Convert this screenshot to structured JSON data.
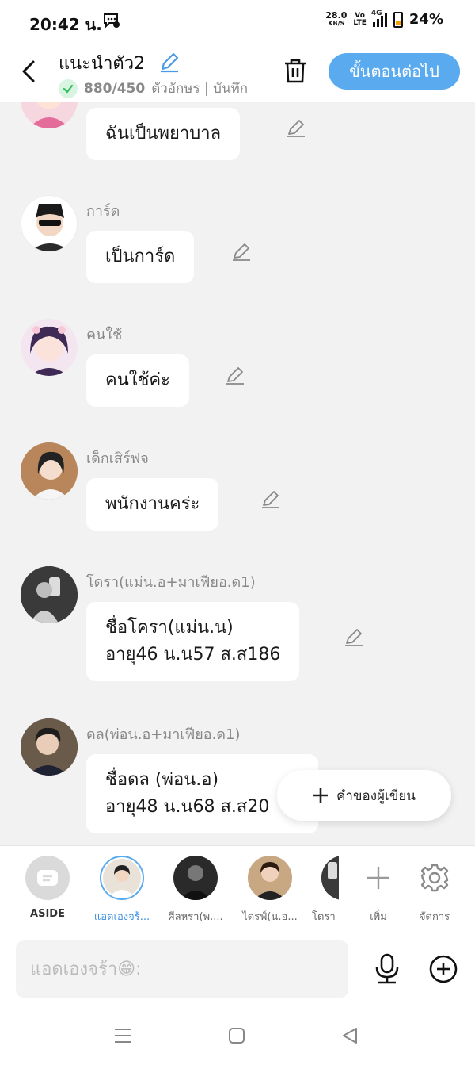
{
  "status_bar": {
    "time": "20:42 น.",
    "speed_value": "28.0",
    "speed_unit": "KB/S",
    "volte_top": "Vo",
    "volte_bottom": "LTE",
    "network": "4G",
    "battery": "24%"
  },
  "header": {
    "title": "แนะนำตัว2",
    "char_count": "880/450",
    "subtitle_rest": "ตัวอักษร | บันทึก",
    "next_button": "ขั้นตอนต่อไป"
  },
  "messages": [
    {
      "name": "",
      "text": "ฉันเป็นพยาบาล"
    },
    {
      "name": "การ์ด",
      "text": "เป็นการ์ด"
    },
    {
      "name": "คนใช้",
      "text": "คนใช้ค่ะ"
    },
    {
      "name": "เด็กเสิร์ฟจ",
      "text": "พนักงานคร่ะ"
    },
    {
      "name": "โดรา(แม่น.อ+มาเฟียอ.ด1)",
      "text": "ชื่อโครา(แม่น.น)\nอายุ46 น.น57 ส.ส186"
    },
    {
      "name": "ดล(พ่อน.อ+มาเฟียอ.ด1)",
      "text": "ชื่อดล (พ่อน.อ)\nอายุ48 น.น68 ส.ส20"
    }
  ],
  "fab": {
    "label": "คำของผู้เขียน"
  },
  "character_bar": {
    "items": [
      {
        "label": "ASIDE"
      },
      {
        "label": "แอดเองจร้..."
      },
      {
        "label": "ศีลหรา(พ...."
      },
      {
        "label": "ไดรฟ์(น.อ..."
      },
      {
        "label": "โดรา"
      },
      {
        "label": "เพิ่ม"
      },
      {
        "label": "จัดการ"
      }
    ]
  },
  "input": {
    "placeholder": "แอดเองจร้า😁:"
  },
  "colors": {
    "accent": "#5aaaf0",
    "background": "#f2f2f2",
    "selected_label": "#3a8fe0"
  }
}
